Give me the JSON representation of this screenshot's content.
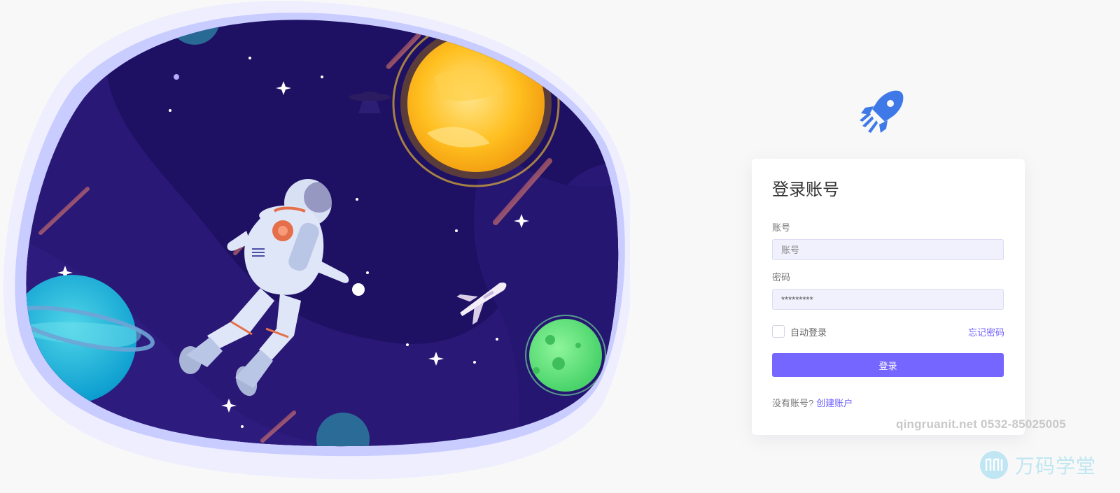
{
  "login": {
    "title": "登录账号",
    "account_label": "账号",
    "account_placeholder": "账号",
    "password_label": "密码",
    "password_value": "*********",
    "remember_label": "自动登录",
    "forgot_link": "忘记密码",
    "submit_label": "登录",
    "signup_prompt": "没有账号?",
    "signup_link": "创建账户"
  },
  "watermark": {
    "contact": "qingruanit.net 0532-85025005",
    "brand": "万码学堂"
  },
  "colors": {
    "accent": "#7566ff",
    "link": "#6f62ff",
    "logo": "#3f79e8",
    "input_bg": "#f1f1fd",
    "space_bg": "#1e1063"
  },
  "icons": {
    "brand": "rocket-icon",
    "watermark": "wanma-logo-icon"
  }
}
